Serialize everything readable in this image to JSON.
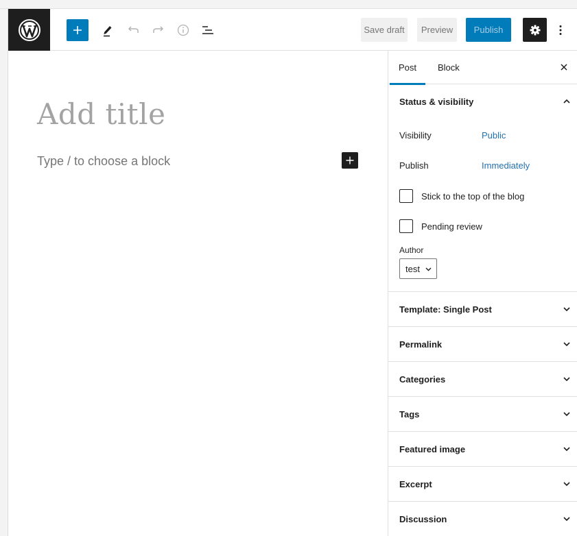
{
  "toolbar": {
    "logo_icon": "wordpress-logo-icon",
    "save_draft_label": "Save draft",
    "preview_label": "Preview",
    "publish_label": "Publish",
    "accent_color": "#007cba"
  },
  "editor": {
    "title_placeholder": "Add title",
    "block_placeholder": "Type / to choose a block"
  },
  "sidebar": {
    "tabs": [
      "Post",
      "Block"
    ],
    "active_tab": "Post",
    "status_panel": {
      "title": "Status & visibility",
      "visibility_label": "Visibility",
      "visibility_value": "Public",
      "publish_label": "Publish",
      "publish_value": "Immediately",
      "sticky_label": "Stick to the top of the blog",
      "sticky_checked": false,
      "pending_label": "Pending review",
      "pending_checked": false,
      "author_label": "Author",
      "author_value": "test"
    },
    "panels": [
      "Template: Single Post",
      "Permalink",
      "Categories",
      "Tags",
      "Featured image",
      "Excerpt",
      "Discussion"
    ]
  }
}
